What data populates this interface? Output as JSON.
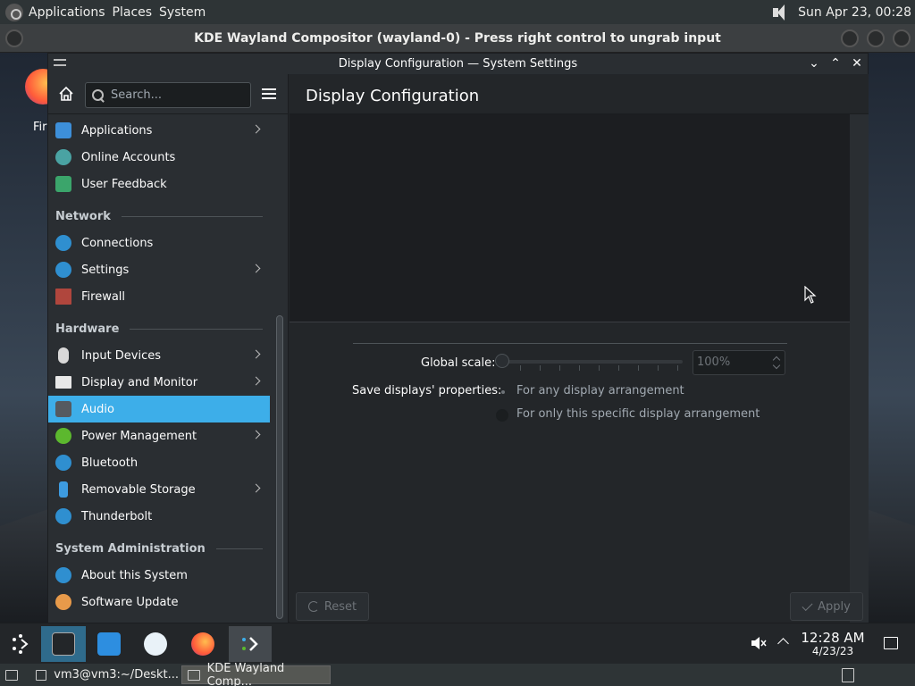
{
  "top_panel": {
    "menus": [
      "Applications",
      "Places",
      "System"
    ],
    "datetime": "Sun Apr 23, 00:28"
  },
  "compositor": {
    "title": "KDE Wayland Compositor (wayland-0) - Press right control to ungrab input"
  },
  "desktop": {
    "firefox_label": "Fir"
  },
  "window": {
    "title": "Display Configuration — System Settings"
  },
  "sidebar": {
    "search_placeholder": "Search...",
    "items_top": [
      {
        "label": "Applications",
        "icon": "applications-icon",
        "color": "#3d8fd9",
        "chevron": true
      },
      {
        "label": "Online Accounts",
        "icon": "online-accounts-icon",
        "color": "#4aa3a3",
        "chevron": false
      },
      {
        "label": "User Feedback",
        "icon": "user-feedback-icon",
        "color": "#3ba56b",
        "chevron": false
      }
    ],
    "section_network": "Network",
    "items_network": [
      {
        "label": "Connections",
        "icon": "globe-icon",
        "color": "#2f8fd0",
        "chevron": false
      },
      {
        "label": "Settings",
        "icon": "globe-settings-icon",
        "color": "#2f8fd0",
        "chevron": true
      },
      {
        "label": "Firewall",
        "icon": "firewall-icon",
        "color": "#b0463d",
        "chevron": false
      }
    ],
    "section_hardware": "Hardware",
    "items_hardware": [
      {
        "label": "Input Devices",
        "icon": "mouse-icon",
        "color": "#d8d8d8",
        "chevron": true
      },
      {
        "label": "Display and Monitor",
        "icon": "monitor-icon",
        "color": "#e8e8e8",
        "chevron": true
      },
      {
        "label": "Audio",
        "icon": "speaker-icon",
        "color": "#555a60",
        "chevron": false,
        "selected": true
      },
      {
        "label": "Power Management",
        "icon": "power-icon",
        "color": "#5cb82e",
        "chevron": true
      },
      {
        "label": "Bluetooth",
        "icon": "bluetooth-icon",
        "color": "#2f8fd0",
        "chevron": false
      },
      {
        "label": "Removable Storage",
        "icon": "usb-icon",
        "color": "#3d9be0",
        "chevron": true
      },
      {
        "label": "Thunderbolt",
        "icon": "thunderbolt-icon",
        "color": "#2f8fd0",
        "chevron": false
      }
    ],
    "section_sysadmin": "System Administration",
    "items_sysadmin": [
      {
        "label": "About this System",
        "icon": "info-icon",
        "color": "#2f8fd0",
        "chevron": false
      },
      {
        "label": "Software Update",
        "icon": "update-icon",
        "color": "#e89a4a",
        "chevron": false
      }
    ]
  },
  "content": {
    "page_title": "Display Configuration",
    "global_scale_label": "Global scale:",
    "global_scale_value": "100%",
    "save_label": "Save displays' properties:",
    "radio_any": "For any display arrangement",
    "radio_specific": "For only this specific display arrangement",
    "reset_label": "Reset",
    "apply_label": "Apply"
  },
  "kde_panel": {
    "clock_time": "12:28 AM",
    "clock_date": "4/23/23"
  },
  "bottom_bar": {
    "tasks": [
      "vm3@vm3:~/Deskt...",
      "KDE Wayland Comp..."
    ]
  }
}
